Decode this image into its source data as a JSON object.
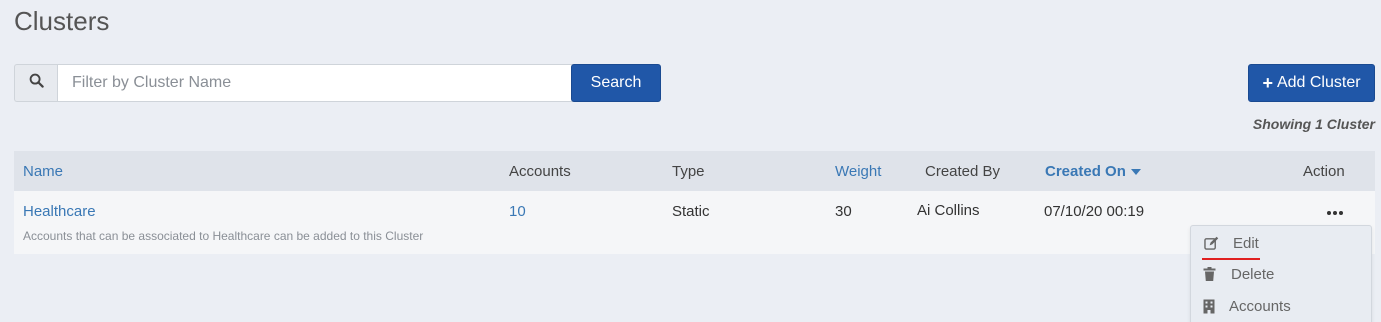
{
  "page": {
    "title": "Clusters"
  },
  "search": {
    "placeholder": "Filter by Cluster Name",
    "value": "",
    "button_label": "Search",
    "icon": "search-icon"
  },
  "toolbar": {
    "add_label": "Add Cluster",
    "add_icon": "plus-icon"
  },
  "summary": {
    "showing": "Showing 1 Cluster"
  },
  "table": {
    "columns": [
      {
        "label": "Name",
        "sortable": true
      },
      {
        "label": "Accounts",
        "sortable": false
      },
      {
        "label": "Type",
        "sortable": false
      },
      {
        "label": "Weight",
        "sortable": true
      },
      {
        "label": "Created By",
        "sortable": false
      },
      {
        "label": "Created On",
        "sortable": true,
        "sorted": "desc"
      },
      {
        "label": "Action",
        "sortable": false
      }
    ],
    "rows": [
      {
        "name": "Healthcare",
        "description": "Accounts that can be associated to Healthcare can be added to this Cluster",
        "accounts": "10",
        "type": "Static",
        "weight": "30",
        "created_by": "Ai Collins",
        "created_on": "07/10/20 00:19",
        "action_icon": "more-horizontal-icon"
      }
    ]
  },
  "action_menu": {
    "items": [
      {
        "label": "Edit",
        "icon": "edit-icon"
      },
      {
        "label": "Delete",
        "icon": "trash-icon"
      },
      {
        "label": "Accounts",
        "icon": "building-icon"
      }
    ]
  },
  "colors": {
    "primary": "#2057a8",
    "link": "#3a78b5",
    "highlight_underline": "#e02020",
    "background": "#ebeef4"
  }
}
